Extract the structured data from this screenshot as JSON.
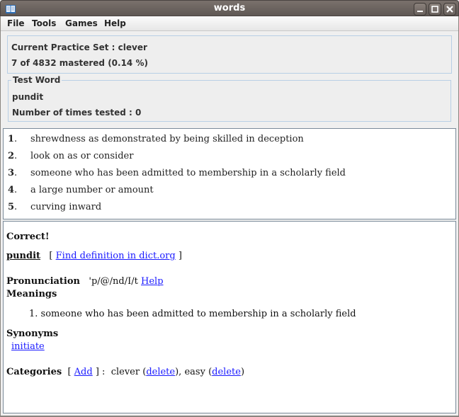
{
  "window": {
    "title": "words",
    "app_icon": "book-icon",
    "controls": {
      "minimize": "minimize-icon",
      "maximize": "maximize-icon",
      "close": "close-icon"
    }
  },
  "menubar": {
    "items": [
      {
        "label": "File"
      },
      {
        "label": "Tools"
      },
      {
        "label": "Games"
      },
      {
        "label": "Help"
      }
    ]
  },
  "practice": {
    "set_label": "Current Practice Set : clever",
    "progress_text": "7 of 4832 mastered (0.14 %)",
    "mastered": 7,
    "total": 4832,
    "percent": 0.14
  },
  "test_word": {
    "legend": "Test Word",
    "word": "pundit",
    "times_tested_label": "Number of times tested : 0"
  },
  "choices": [
    {
      "num": "1",
      "text": "shrewdness as demonstrated by being skilled in deception"
    },
    {
      "num": "2",
      "text": "look on as or consider"
    },
    {
      "num": "3",
      "text": "someone who has been admitted to membership in a scholarly field"
    },
    {
      "num": "4",
      "text": "a large number or amount"
    },
    {
      "num": "5",
      "text": "curving inward"
    }
  ],
  "details": {
    "result": "Correct!",
    "word": "pundit",
    "dict_link": "Find definition in dict.org",
    "pronunciation_label": "Pronunciation",
    "pronunciation": "'p/@/nd/I/t",
    "help_link": "Help",
    "meanings_label": "Meanings",
    "meanings": [
      "1. someone who has been admitted to membership in a scholarly field"
    ],
    "synonyms_label": "Synonyms",
    "synonyms": [
      "initiate"
    ],
    "categories_label": "Categories",
    "add_link": "Add",
    "categories": [
      {
        "name": "clever",
        "delete_link": "delete"
      },
      {
        "name": "easy",
        "delete_link": "delete"
      }
    ]
  }
}
